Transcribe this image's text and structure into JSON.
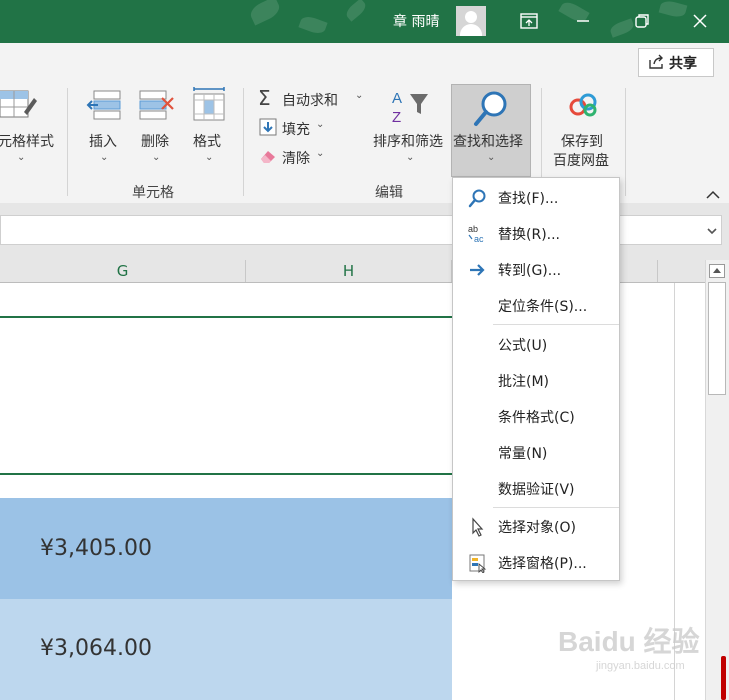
{
  "titlebar": {
    "user_name": "章 雨晴",
    "restore_glyph": "⧉",
    "close_glyph": "✕",
    "ribbon_display_glyph": "⊡"
  },
  "ribbon": {
    "share_label": "共享",
    "cell_styles_label": "元格样式",
    "cells_group": {
      "label": "单元格",
      "insert_label": "插入",
      "delete_label": "删除",
      "format_label": "格式"
    },
    "editing_group": {
      "label": "编辑",
      "autosum_label": "自动求和",
      "fill_label": "填充",
      "clear_label": "清除",
      "sort_filter_label": "排序和筛选",
      "find_select_label": "查找和选择"
    },
    "baidu": {
      "line1": "保存到",
      "line2": "百度网盘"
    },
    "collapse_glyph": "^"
  },
  "columns": [
    "G",
    "H"
  ],
  "cells": {
    "h_row1": "¥3,405.00",
    "h_row2": "¥3,064.00"
  },
  "menu": {
    "items": [
      {
        "label": "查找(F)...",
        "icon": "search-icon"
      },
      {
        "label": "替换(R)...",
        "icon": "replace-icon"
      },
      {
        "label": "转到(G)...",
        "icon": "goto-arrow-icon"
      },
      {
        "label": "定位条件(S)..."
      },
      {
        "label": "公式(U)"
      },
      {
        "label": "批注(M)"
      },
      {
        "label": "条件格式(C)"
      },
      {
        "label": "常量(N)"
      },
      {
        "label": "数据验证(V)"
      },
      {
        "label": "选择对象(O)",
        "icon": "pointer-icon"
      },
      {
        "label": "选择窗格(P)...",
        "icon": "selection-pane-icon"
      }
    ]
  },
  "watermark": {
    "brand": "Baidu 经验",
    "url": "jingyan.baidu.com"
  },
  "colors": {
    "excel_green": "#217346",
    "row_blue_dark": "#9bc2e6",
    "row_blue_light": "#bdd7ee"
  }
}
